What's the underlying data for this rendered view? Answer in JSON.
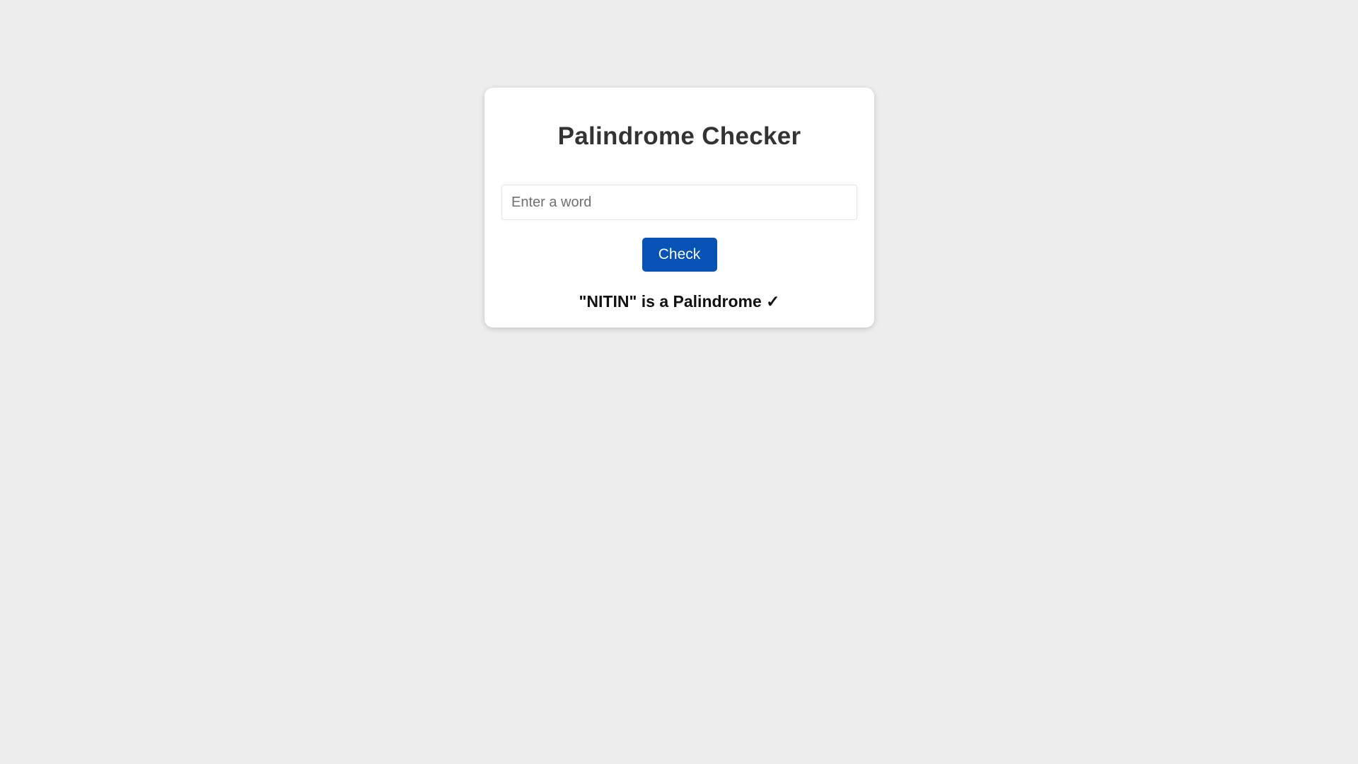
{
  "card": {
    "title": "Palindrome Checker",
    "input": {
      "value": "",
      "placeholder": "Enter a word"
    },
    "check_label": "Check",
    "result_text": "\"NITIN\" is a Palindrome ✓"
  },
  "colors": {
    "background": "#ededed",
    "card": "#ffffff",
    "button": "#0652b5",
    "title": "#333333"
  }
}
